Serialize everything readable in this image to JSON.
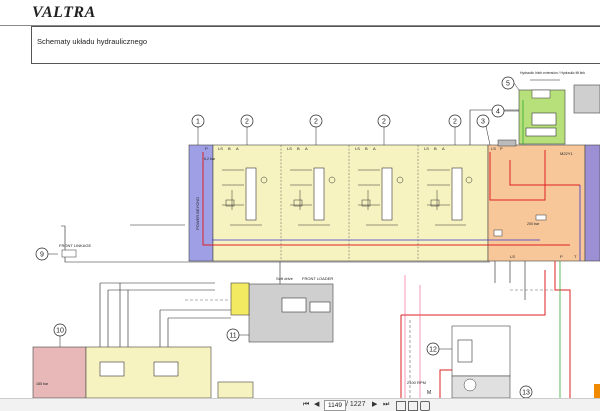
{
  "header": {
    "logo": "VALTRA",
    "title": "Schematy układu hydraulicznego"
  },
  "callouts": [
    "1",
    "2",
    "2",
    "2",
    "2",
    "3",
    "4",
    "5",
    "9",
    "10",
    "11",
    "12",
    "13"
  ],
  "labels": {
    "power_beyond": "POWER BEYOND",
    "front_linkage": "FRONT LINKAGE",
    "soft_drive": "Soft drive",
    "front_loader": "FRONT LOADER",
    "hitch_ext": "Hydraulic hitch extension / Hydraulic lift link",
    "bar_62": "6,2 bar",
    "bar_200": "200 bar",
    "bar_185": "185 bar",
    "rpm": "2100 RPM",
    "m": "M",
    "ls": "LS",
    "p": "P",
    "t": "T",
    "a": "A",
    "b": "B",
    "m22y1": "M22Y1"
  },
  "toolbar": {
    "current_page": "1149",
    "total_pages": "/ 1227",
    "first": "⏮",
    "prev": "◀",
    "next": "▶",
    "last": "⏭"
  },
  "colors": {
    "valve_block": "#f7f3c0",
    "power_beyond": "#9f9fe6",
    "main_valve": "#f7c79a",
    "hitch_ext": "#b7e07a",
    "frame_right": "#9d8fd4",
    "pink_block": "#e8b8b8",
    "red_line": "#d22",
    "blue_line": "#33c"
  }
}
